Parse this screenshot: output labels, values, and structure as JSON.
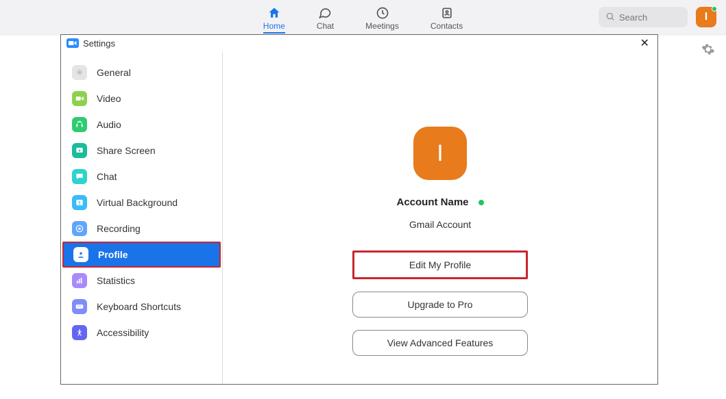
{
  "header": {
    "nav": [
      {
        "label": "Home",
        "active": true
      },
      {
        "label": "Chat",
        "active": false
      },
      {
        "label": "Meetings",
        "active": false
      },
      {
        "label": "Contacts",
        "active": false
      }
    ],
    "search_placeholder": "Search",
    "avatar_initial": "I"
  },
  "settings": {
    "title": "Settings",
    "sidebar": [
      {
        "label": "General"
      },
      {
        "label": "Video"
      },
      {
        "label": "Audio"
      },
      {
        "label": "Share Screen"
      },
      {
        "label": "Chat"
      },
      {
        "label": "Virtual Background"
      },
      {
        "label": "Recording"
      },
      {
        "label": "Profile",
        "active": true
      },
      {
        "label": "Statistics"
      },
      {
        "label": "Keyboard Shortcuts"
      },
      {
        "label": "Accessibility"
      }
    ],
    "profile": {
      "avatar_initial": "I",
      "account_name": "Account Name",
      "account_sub": "Gmail Account",
      "buttons": {
        "edit": "Edit My Profile",
        "upgrade": "Upgrade to Pro",
        "advanced": "View Advanced Features"
      }
    }
  }
}
